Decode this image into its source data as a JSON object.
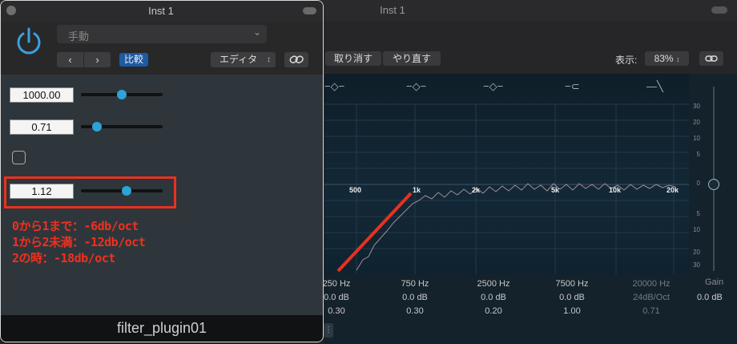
{
  "eq_window": {
    "title": "Inst 1",
    "undo_label": "取り消す",
    "redo_label": "やり直す",
    "view_label": "表示:",
    "zoom_value": "83%",
    "freq_labels": [
      "500",
      "1k",
      "2k",
      "5k",
      "10k",
      "20k"
    ],
    "gain_ticks": [
      "30",
      "20",
      "10",
      "5",
      "0",
      "5",
      "10",
      "20",
      "30"
    ],
    "gain_label": "Gain",
    "gain_value": "0.0 dB",
    "bands": [
      {
        "freq": "250 Hz",
        "gain": "0.0 dB",
        "q": "0.30",
        "icon": "bell-filter-icon"
      },
      {
        "freq": "750 Hz",
        "gain": "0.0 dB",
        "q": "0.30",
        "icon": "bell-filter-icon"
      },
      {
        "freq": "2500 Hz",
        "gain": "0.0 dB",
        "q": "0.20",
        "icon": "bell-filter-icon"
      },
      {
        "freq": "7500 Hz",
        "gain": "0.0 dB",
        "q": "1.00",
        "icon": "high-shelf-icon"
      },
      {
        "freq": "20000 Hz",
        "gain": "24dB/Oct",
        "q": "0.71",
        "icon": "low-pass-icon"
      }
    ]
  },
  "plugin": {
    "title": "Inst 1",
    "preset": "手動",
    "prev_glyph": "‹",
    "next_glyph": "›",
    "compare_label": "比較",
    "editor_label": "エディタ",
    "params": [
      {
        "value": "1000.00",
        "level": 0.5
      },
      {
        "value": "0.71",
        "level": 0.2
      },
      {
        "value": "1.12",
        "level": 0.56
      }
    ],
    "checkbox_checked": false,
    "notes": [
      "0から1まで：-6db/oct",
      "1から2未満：-12db/oct",
      "2の時：-18db/oct"
    ],
    "name": "filter_plugin01"
  },
  "colors": {
    "accent": "#2ea3d6",
    "annotation": "#f0301f",
    "compare_bg": "#1e5aa0"
  }
}
